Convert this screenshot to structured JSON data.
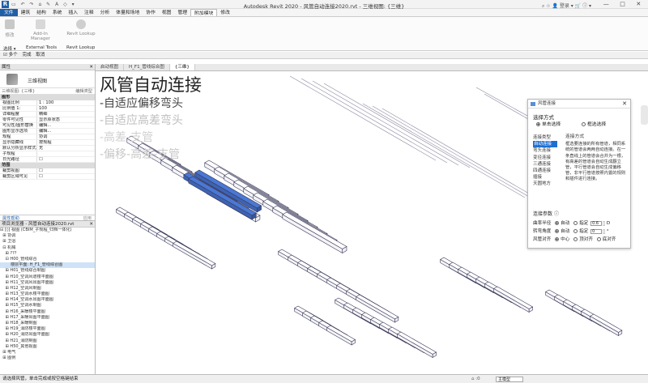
{
  "window": {
    "title": "Autodesk Revit 2020 - 风管自动连接2020.rvt - 三维视图: {三维}",
    "app_letter": "R",
    "qat": "▭ ↶ ↷ ⌂ ✎ A ◇ ▾",
    "right_text": "⌕ ☆ 👤 登录 ▾ 🛒 ⓘ ▾",
    "controls": [
      "—",
      "□",
      "✕"
    ]
  },
  "menu": {
    "file": "文件",
    "tabs": [
      "建筑",
      "结构",
      "系统",
      "插入",
      "注释",
      "分析",
      "体量和场地",
      "协作",
      "视图",
      "管理",
      "附加模块",
      "修改"
    ],
    "active_tab": "附加模块"
  },
  "ribbon": {
    "buttons": [
      "修改",
      "Add-In Manager",
      "Revit Lookup"
    ],
    "groups": [
      "选择 ▾",
      "External Tools",
      "Revit Lookup"
    ]
  },
  "options_bar": {
    "items": [
      "☑ 多个",
      "完成",
      "取消"
    ]
  },
  "properties": {
    "title": "属性",
    "close": "✕",
    "type_name": "三维视图",
    "view_selector": "三维视图: {三维}",
    "edit_type": "编辑类型",
    "section_graphics": "图形",
    "rows": [
      {
        "k": "视图比例",
        "v": "1 : 100"
      },
      {
        "k": "比例值 1:",
        "v": "100"
      },
      {
        "k": "详细程度",
        "v": "精细"
      },
      {
        "k": "零件可见性",
        "v": "显示原状态"
      },
      {
        "k": "可见性/图形替换",
        "v": "编辑..."
      },
      {
        "k": "图形显示选项",
        "v": "编辑..."
      },
      {
        "k": "规程",
        "v": "协调"
      },
      {
        "k": "显示隐藏线",
        "v": "按规程"
      },
      {
        "k": "默认分析显示样式",
        "v": "无"
      },
      {
        "k": "子规程",
        "v": ""
      },
      {
        "k": "日光路径",
        "v": "☐"
      }
    ],
    "section_range": "范围",
    "range_rows": [
      {
        "k": "裁剪视图",
        "v": "☐"
      },
      {
        "k": "裁剪区域可见",
        "v": "☐"
      }
    ],
    "help": "属性帮助",
    "apply": "应用"
  },
  "browser": {
    "title": "项目浏览器 - 风管自动连接2020.rvt",
    "close": "✕",
    "items": [
      "⊟ [◊] 视图 (CBIM_子规程_归档一体化)",
      "  ⊞ 协调",
      "  ⊞ 卫浴",
      "  ⊟ 机械",
      "    ⊞ ???",
      "    ⊟ H00_管线综合",
      "        楼层平面: H_F1_管线综合图",
      "    ⊞ H01_管线综合制图",
      "    ⊞ H10_空调风道楼平面图",
      "    ⊞ H11_空调风出图平面图",
      "    ⊞ H12_空调风制图",
      "    ⊞ H13_空调水楼平面图",
      "    ⊞ H14_空调水出图平面图",
      "    ⊞ H15_空调水制图",
      "    ⊞ H16_采暖楼平面图",
      "    ⊞ H17_采暖出图平面图",
      "    ⊞ H18_采暖制图",
      "    ⊞ H19_消防楼平面图",
      "    ⊞ H20_消防出图平面图",
      "    ⊞ H21_消防制图",
      "    ⊞ H50_其他视图",
      "  ⊞ 电气",
      "  ⊞ 图例"
    ],
    "selected_index": 6
  },
  "view_tabs": [
    "启动视图",
    "H_F1_管线综合图",
    "{三维}"
  ],
  "view_tab_active": 2,
  "overlay": {
    "title": "风管自动连接",
    "items": [
      "-自适应偏移弯头",
      "-自适应高差弯头",
      "-高差-支管",
      "-偏移-高差-支管"
    ]
  },
  "dialog": {
    "title": "风管连接",
    "close": "✕",
    "select_mode_label": "选择方式",
    "single_select": "单击选择",
    "box_select": "框选选择",
    "types_header": "连接类型",
    "types": [
      "自动连接",
      "弯头连接",
      "变径连接",
      "三通连接",
      "四通连接",
      "插接",
      "天圆地方"
    ],
    "selected_type": 0,
    "desc_header": "连接方式",
    "description": "框选要连接的所有管道，相同系统的管道会两两自动连接。在一条直线上的管道会合并为一根，有高差的管道会自动生成翻立管，平行管道会自动生成偏移管，非平行管道按照内置的规则和插件进行连接。",
    "params_label": "连接参数",
    "params_help": "ⓘ",
    "radius_label": "曲率半径",
    "angle_label": "转弯角度",
    "align_label": "风管对齐",
    "auto": "自动",
    "specify": "指定",
    "radius_value": "0.6",
    "radius_unit": "D",
    "angle_value": "0",
    "angle_unit": "°",
    "align_options": [
      "中心",
      "顶对齐",
      "底对齐"
    ]
  },
  "status": {
    "text": "请选择风管，单击完成或按空格键结束",
    "right": "⌂ :0",
    "model": "主模型"
  },
  "colors": {
    "accent": "#1f5fa8",
    "highlight_duct": "#4a78d4"
  }
}
